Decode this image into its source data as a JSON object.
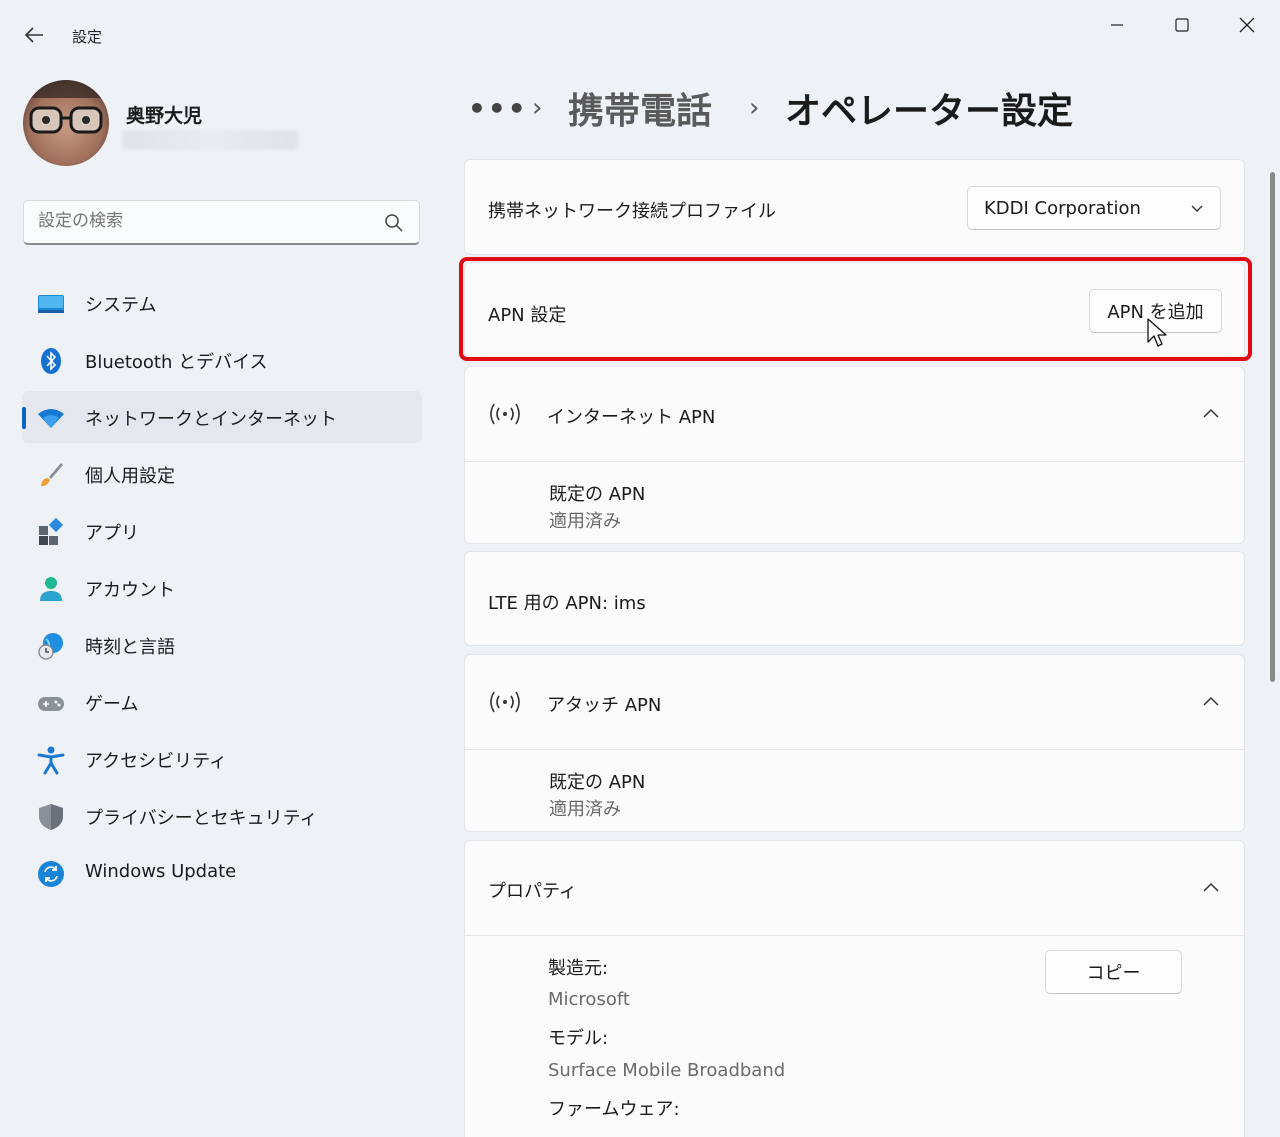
{
  "window": {
    "title": "設定",
    "controls": [
      "minimize",
      "maximize",
      "close"
    ]
  },
  "profile": {
    "name": "奥野大児"
  },
  "search": {
    "placeholder": "設定の検索"
  },
  "nav": {
    "items": [
      {
        "label": "システム",
        "icon": "system-icon"
      },
      {
        "label": "Bluetooth とデバイス",
        "icon": "bluetooth-icon"
      },
      {
        "label": "ネットワークとインターネット",
        "icon": "wifi-icon",
        "selected": true
      },
      {
        "label": "個人用設定",
        "icon": "brush-icon"
      },
      {
        "label": "アプリ",
        "icon": "apps-icon"
      },
      {
        "label": "アカウント",
        "icon": "account-icon"
      },
      {
        "label": "時刻と言語",
        "icon": "globe-clock-icon"
      },
      {
        "label": "ゲーム",
        "icon": "gamepad-icon"
      },
      {
        "label": "アクセシビリティ",
        "icon": "accessibility-icon"
      },
      {
        "label": "プライバシーとセキュリティ",
        "icon": "shield-icon"
      },
      {
        "label": "Windows Update",
        "icon": "update-icon"
      }
    ]
  },
  "breadcrumb": {
    "more": "•••",
    "sep": "›",
    "parent": "携帯電話",
    "current": "オペレーター設定"
  },
  "profile_card": {
    "label": "携帯ネットワーク接続プロファイル",
    "selected": "KDDI Corporation"
  },
  "apn_card": {
    "label": "APN 設定",
    "button": "APN を追加"
  },
  "internet_apn": {
    "title": "インターネット APN",
    "item_title": "既定の APN",
    "item_status": "適用済み"
  },
  "lte_card": {
    "label": "LTE 用の APN: ims"
  },
  "attach_apn": {
    "title": "アタッチ APN",
    "item_title": "既定の APN",
    "item_status": "適用済み"
  },
  "properties": {
    "title": "プロパティ",
    "copy_button": "コピー",
    "manufacturer_label": "製造元:",
    "manufacturer_value": "Microsoft",
    "model_label": "モデル:",
    "model_value": "Surface Mobile Broadband",
    "firmware_label": "ファームウェア:"
  },
  "colors": {
    "accent": "#0a64c8",
    "highlight": "#e20a12"
  }
}
